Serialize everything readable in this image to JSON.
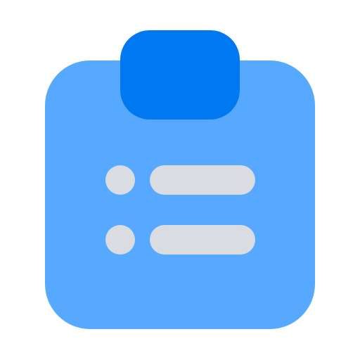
{
  "icon": {
    "name": "clipboard-list-icon",
    "colors": {
      "board": "#56A9FF",
      "clip": "#0078F0",
      "list_marks": "#D9DCE1",
      "background": "#FFFFFF"
    },
    "list_items": 2
  }
}
